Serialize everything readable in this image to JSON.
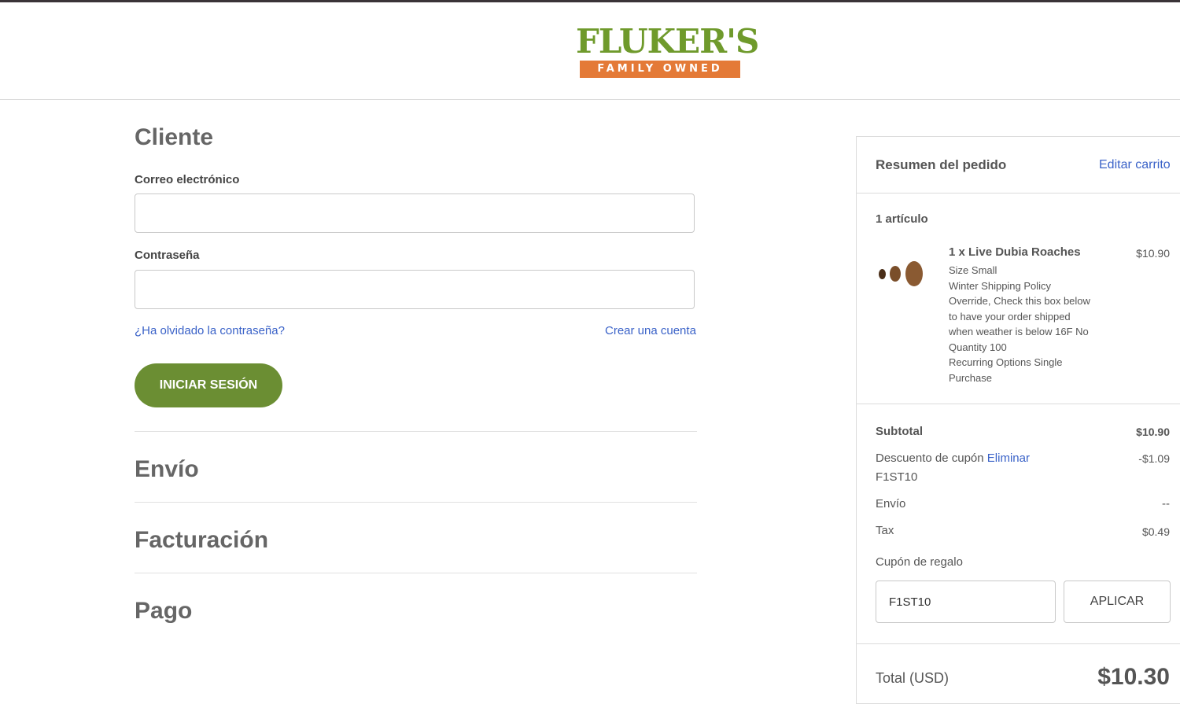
{
  "brand": {
    "name": "FLUKER'S",
    "tagline": "FAMILY OWNED"
  },
  "customer": {
    "title": "Cliente",
    "email_label": "Correo electrónico",
    "email_value": "",
    "password_label": "Contraseña",
    "password_value": "",
    "forgot_link": "¿Ha olvidado la contraseña?",
    "create_link": "Crear una cuenta",
    "login_button": "INICIAR SESIÓN"
  },
  "steps": {
    "shipping": "Envío",
    "billing": "Facturación",
    "payment": "Pago"
  },
  "summary": {
    "title": "Resumen del pedido",
    "edit_link": "Editar carrito",
    "item_count": "1 artículo",
    "product": {
      "name": "1 x Live Dubia Roaches",
      "price": "$10.90",
      "details": [
        "Size Small",
        "Winter Shipping Policy",
        "Override, Check this box below",
        "to have your order shipped",
        "when weather is below 16F No",
        "Quantity 100",
        "Recurring Options Single",
        "Purchase"
      ]
    },
    "subtotal_label": "Subtotal",
    "subtotal_value": "$10.90",
    "discount_label": "Descuento de cupón",
    "discount_remove": "Eliminar",
    "discount_code": "F1ST10",
    "discount_value": "-$1.09",
    "shipping_label": "Envío",
    "shipping_value": "--",
    "tax_label": "Tax",
    "tax_value": "$0.49",
    "gift_label": "Cupón de regalo",
    "gift_value": "F1ST10",
    "apply_button": "APLICAR",
    "total_label": "Total (USD)",
    "total_value": "$10.30"
  },
  "colors": {
    "brand_green": "#6b8e33",
    "link_blue": "#3a62c8",
    "ribbon_orange": "#e47a37"
  }
}
